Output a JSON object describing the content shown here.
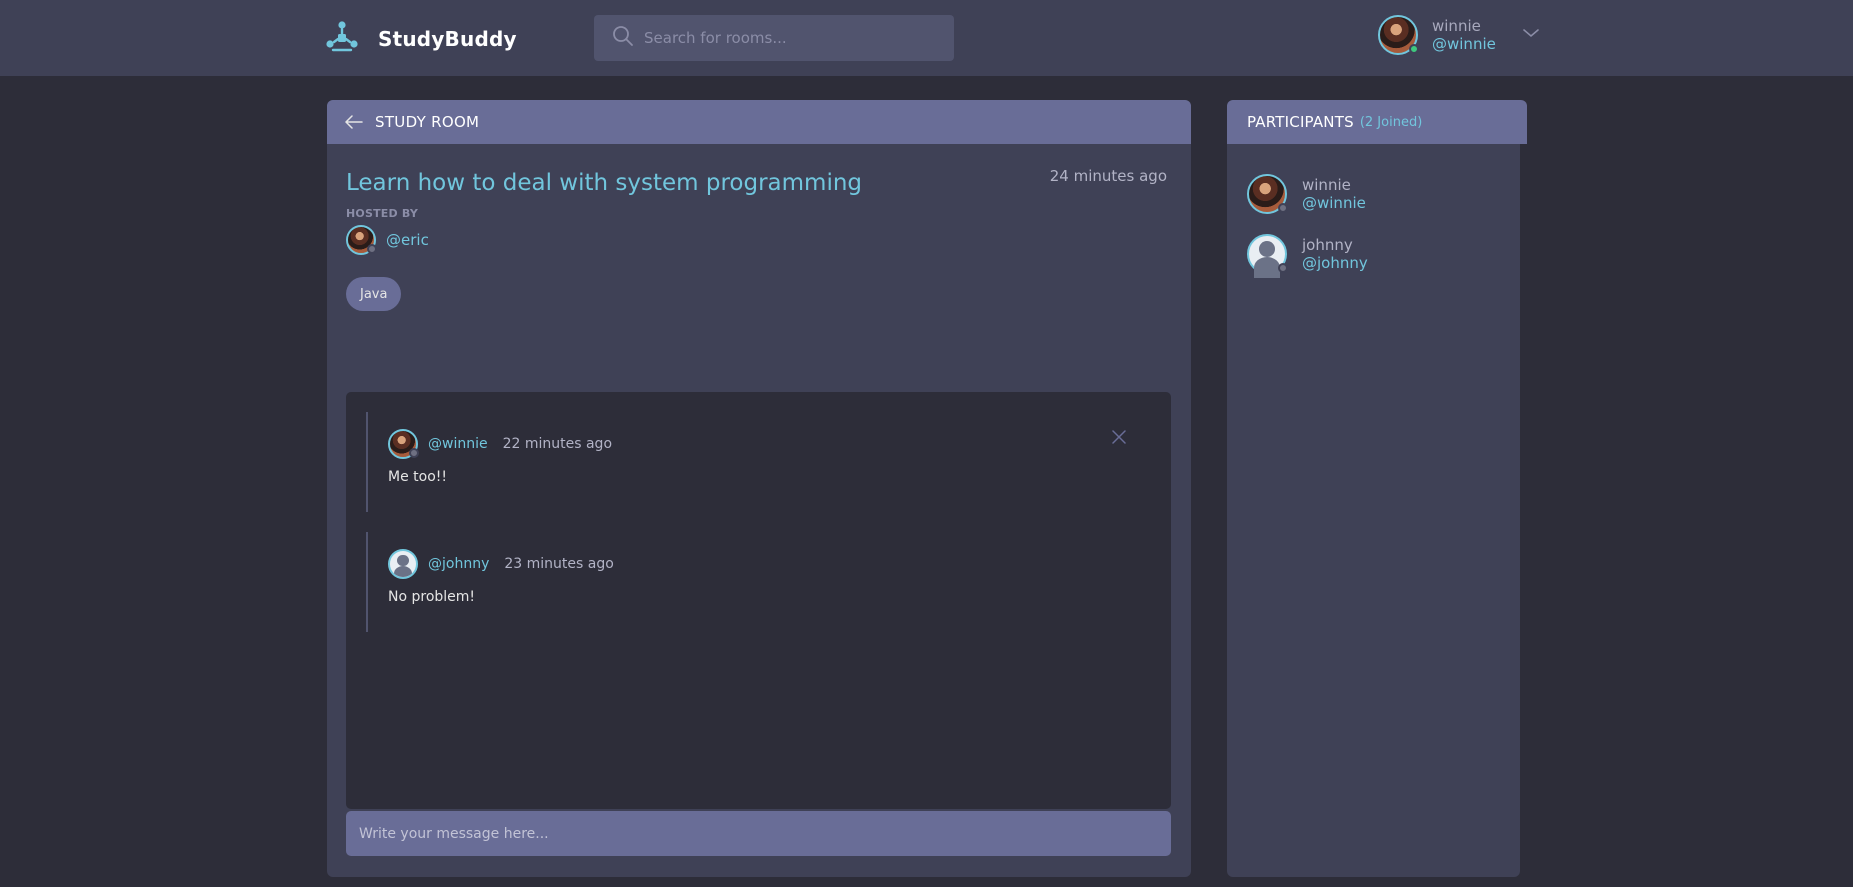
{
  "app": {
    "name": "StudyBuddy",
    "brand_color": "#71c6dd",
    "icon": "logo-icon"
  },
  "search": {
    "placeholder": "Search for rooms...",
    "icon": "search-icon"
  },
  "current_user": {
    "name": "winnie",
    "handle": "@winnie",
    "status": "online"
  },
  "room": {
    "header_label": "STUDY ROOM",
    "title": "Learn how to deal with system programming",
    "created": "24 minutes ago",
    "hosted_by_label": "HOSTED BY",
    "host_handle": "@eric",
    "topic": "Java"
  },
  "messages": [
    {
      "handle": "@winnie",
      "time": "22 minutes ago",
      "body": "Me too!!",
      "avatar": "photo",
      "deletable": true
    },
    {
      "handle": "@johnny",
      "time": "23 minutes ago",
      "body": "No problem!",
      "avatar": "default",
      "deletable": false
    }
  ],
  "composer": {
    "placeholder": "Write your message here..."
  },
  "participants": {
    "title": "PARTICIPANTS",
    "count_label": "(2 Joined)",
    "items": [
      {
        "name": "winnie",
        "handle": "@winnie",
        "avatar": "photo"
      },
      {
        "name": "johnny",
        "handle": "@johnny",
        "avatar": "default"
      }
    ]
  }
}
